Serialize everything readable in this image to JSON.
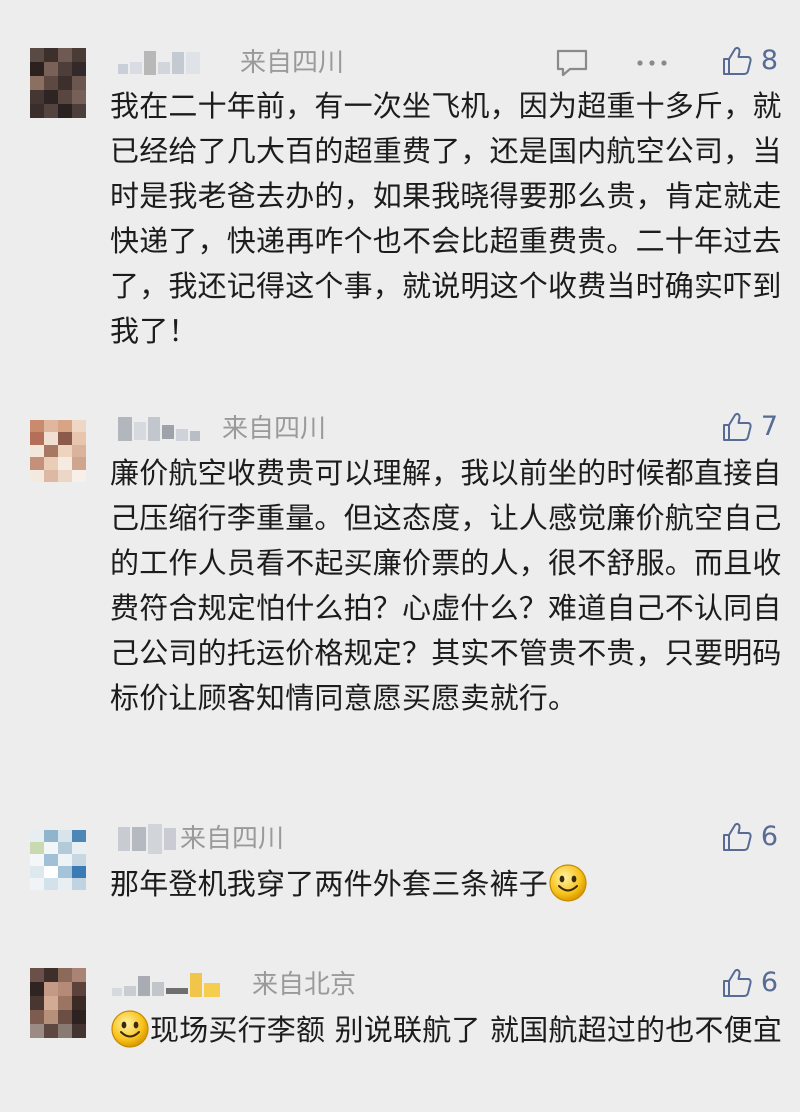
{
  "comments": [
    {
      "location": "来自四川",
      "likes": "8",
      "has_reply_actions": true,
      "text": "我在二十年前，有一次坐飞机，因为超重十多斤，就已经给了几大百的超重费了，还是国内航空公司，当时是我老爸去办的，如果我晓得要那么贵，肯定就走快递了，快递再咋个也不会比超重费贵。二十年过去了，我还记得这个事，就说明这个收费当时确实吓到我了！"
    },
    {
      "location": "来自四川",
      "likes": "7",
      "text": "廉价航空收费贵可以理解，我以前坐的时候都直接自己压缩行李重量。但这态度，让人感觉廉价航空自己的工作人员看不起买廉价票的人，很不舒服。而且收费符合规定怕什么拍？心虚什么？难道自己不认同自己公司的托运价格规定？其实不管贵不贵，只要明码标价让顾客知情同意愿买愿卖就行。"
    },
    {
      "location": "来自四川",
      "likes": "6",
      "text": "那年登机我穿了两件外套三条裤子",
      "emoji": "smile-emoji"
    },
    {
      "location": "来自北京",
      "likes": "6",
      "text": "现场买行李额 别说联航了 就国航超过的也不便宜",
      "emoji": "smile-emoji"
    }
  ],
  "colors": {
    "background": "#ededed",
    "like_blue": "#576b95",
    "meta_gray": "#9a9a9a",
    "text": "#1c1c1c"
  }
}
